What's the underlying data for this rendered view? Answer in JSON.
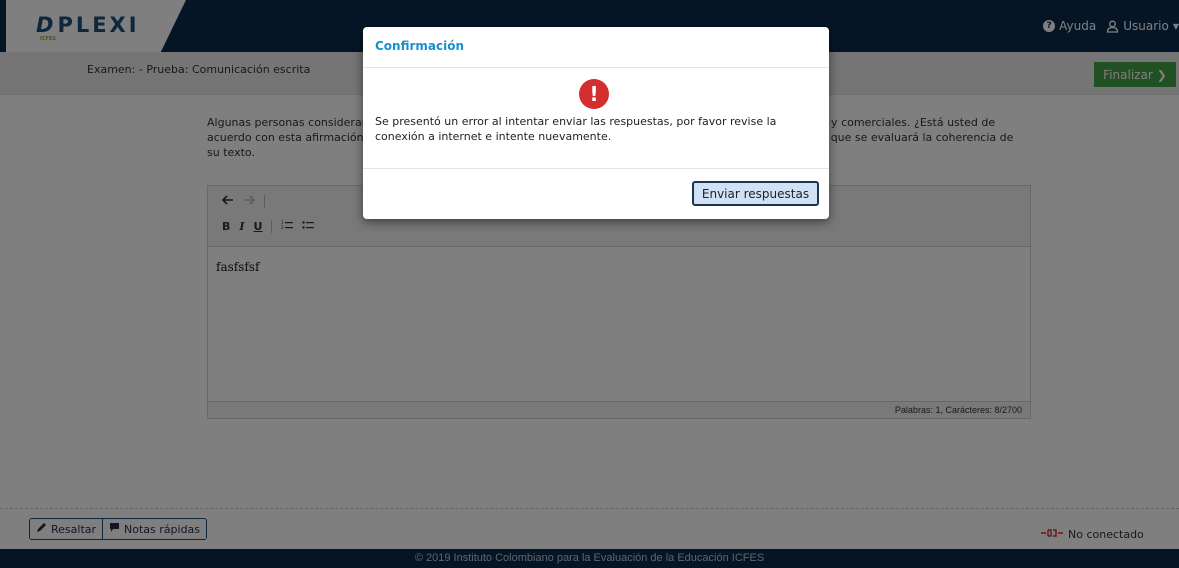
{
  "header": {
    "logo_text": "PLEXI",
    "logo_mark": "D",
    "logo_sub": "ICFES",
    "help_label": "Ayuda",
    "user_label": "Usuario"
  },
  "exam": {
    "title": "Examen: - Prueba: Comunicación escrita",
    "finish_label": "Finalizar"
  },
  "question": {
    "text": "Algunas personas consideran que los medios de comunicación masivos están controlados por intereses políticos y comerciales. ¿Está usted de acuerdo con esta afirmación? Escriba un texto argumentativo donde justifique su posición al respecto. Recuerde que se evaluará la coherencia de su texto."
  },
  "editor": {
    "toolbar": {
      "undo_icon": "undo-icon",
      "redo_icon": "redo-icon",
      "bold": "B",
      "italic": "I",
      "underline": "U",
      "ordered_list_icon": "ordered-list-icon",
      "bullet_list_icon": "bullet-list-icon"
    },
    "content": "fasfsfsf",
    "status": "Palabras: 1, Carácteres: 8/2700"
  },
  "bottom_bar": {
    "highlight_label": "Resaltar",
    "notes_label": "Notas rápidas",
    "connection_status": "No conectado"
  },
  "footer": {
    "text": "© 2019 Instituto Colombiano para la Evaluación de la Educación ICFES"
  },
  "modal": {
    "title": "Confirmación",
    "icon_glyph": "!",
    "message": "Se presentó un error al intentar enviar las respuestas, por favor revise la conexión a internet e intente nuevamente.",
    "button_label": "Enviar respuestas"
  },
  "colors": {
    "header_bg": "#0c2b4c",
    "accent_blue": "#1a8fd0",
    "finish_green": "#43a047",
    "error_red": "#d32f2f",
    "disconnected_red": "#d32f2f"
  }
}
